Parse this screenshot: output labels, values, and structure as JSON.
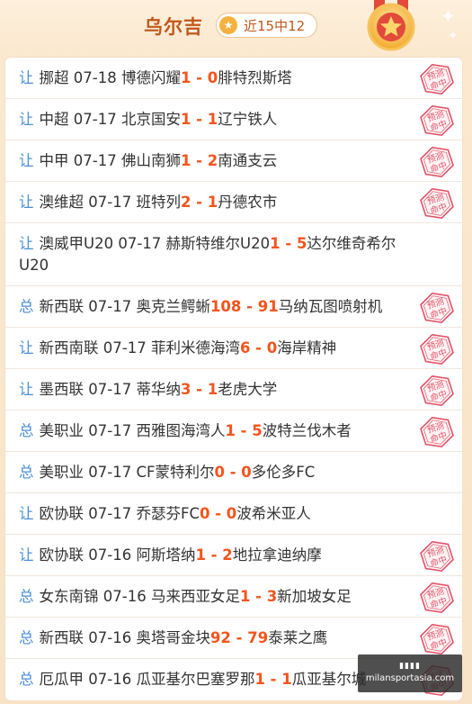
{
  "header": {
    "expert_name": "乌尔吉",
    "record": "近15中12",
    "star_icon": "★"
  },
  "colors": {
    "accent": "#c0581c",
    "score": "#f5541c",
    "type": "#4a8fd7",
    "stamp": "#e0556b"
  },
  "stamp_text": [
    "预测",
    "命中"
  ],
  "matches": [
    {
      "type": "让",
      "league": "挪超",
      "date": "07-18",
      "home": "博德闪耀",
      "home_score": "1",
      "away_score": "0",
      "away": "腓特烈斯塔",
      "hit": true,
      "tall": false
    },
    {
      "type": "让",
      "league": "中超",
      "date": "07-17",
      "home": "北京国安",
      "home_score": "1",
      "away_score": "1",
      "away": "辽宁铁人",
      "hit": true,
      "tall": false
    },
    {
      "type": "让",
      "league": "中甲",
      "date": "07-17",
      "home": "佛山南狮",
      "home_score": "1",
      "away_score": "2",
      "away": "南通支云",
      "hit": true,
      "tall": false
    },
    {
      "type": "让",
      "league": "澳维超",
      "date": "07-17",
      "home": "班特列",
      "home_score": "2",
      "away_score": "1",
      "away": "丹德农市",
      "hit": true,
      "tall": false
    },
    {
      "type": "让",
      "league": "澳威甲U20",
      "date": "07-17",
      "home": "赫斯特维尔U20",
      "home_score": "1",
      "away_score": "5",
      "away": "达尔维奇希尔U20",
      "hit": false,
      "tall": true
    },
    {
      "type": "总",
      "league": "新西联",
      "date": "07-17",
      "home": "奥克兰鳄蜥",
      "home_score": "108",
      "away_score": "91",
      "away": "马纳瓦图喷射机",
      "hit": true,
      "tall": false
    },
    {
      "type": "让",
      "league": "新西南联",
      "date": "07-17",
      "home": "菲利米德海湾",
      "home_score": "6",
      "away_score": "0",
      "away": "海岸精神",
      "hit": true,
      "tall": false
    },
    {
      "type": "让",
      "league": "墨西联",
      "date": "07-17",
      "home": "蒂华纳",
      "home_score": "3",
      "away_score": "1",
      "away": "老虎大学",
      "hit": true,
      "tall": false
    },
    {
      "type": "总",
      "league": "美职业",
      "date": "07-17",
      "home": "西雅图海湾人",
      "home_score": "1",
      "away_score": "5",
      "away": "波特兰伐木者",
      "hit": true,
      "tall": false
    },
    {
      "type": "总",
      "league": "美职业",
      "date": "07-17",
      "home": "CF蒙特利尔",
      "home_score": "0",
      "away_score": "0",
      "away": "多伦多FC",
      "hit": false,
      "tall": false
    },
    {
      "type": "让",
      "league": "欧协联",
      "date": "07-17",
      "home": "乔瑟芬FC",
      "home_score": "0",
      "away_score": "0",
      "away": "波希米亚人",
      "hit": false,
      "tall": false
    },
    {
      "type": "让",
      "league": "欧协联",
      "date": "07-16",
      "home": "阿斯塔纳",
      "home_score": "1",
      "away_score": "2",
      "away": "地拉拿迪纳摩",
      "hit": true,
      "tall": false
    },
    {
      "type": "总",
      "league": "女东南锦",
      "date": "07-16",
      "home": "马来西亚女足",
      "home_score": "1",
      "away_score": "3",
      "away": "新加坡女足",
      "hit": true,
      "tall": false
    },
    {
      "type": "总",
      "league": "新西联",
      "date": "07-16",
      "home": "奥塔哥金块",
      "home_score": "92",
      "away_score": "79",
      "away": "泰莱之鹰",
      "hit": true,
      "tall": false
    },
    {
      "type": "总",
      "league": "厄瓜甲",
      "date": "07-16",
      "home": "瓜亚基尔巴塞罗那",
      "home_score": "1",
      "away_score": "1",
      "away": "瓜亚基尔城",
      "hit": true,
      "tall": false
    }
  ],
  "watermark": {
    "top": "▮▮▮▮",
    "bottom": "milansportasia.com"
  }
}
